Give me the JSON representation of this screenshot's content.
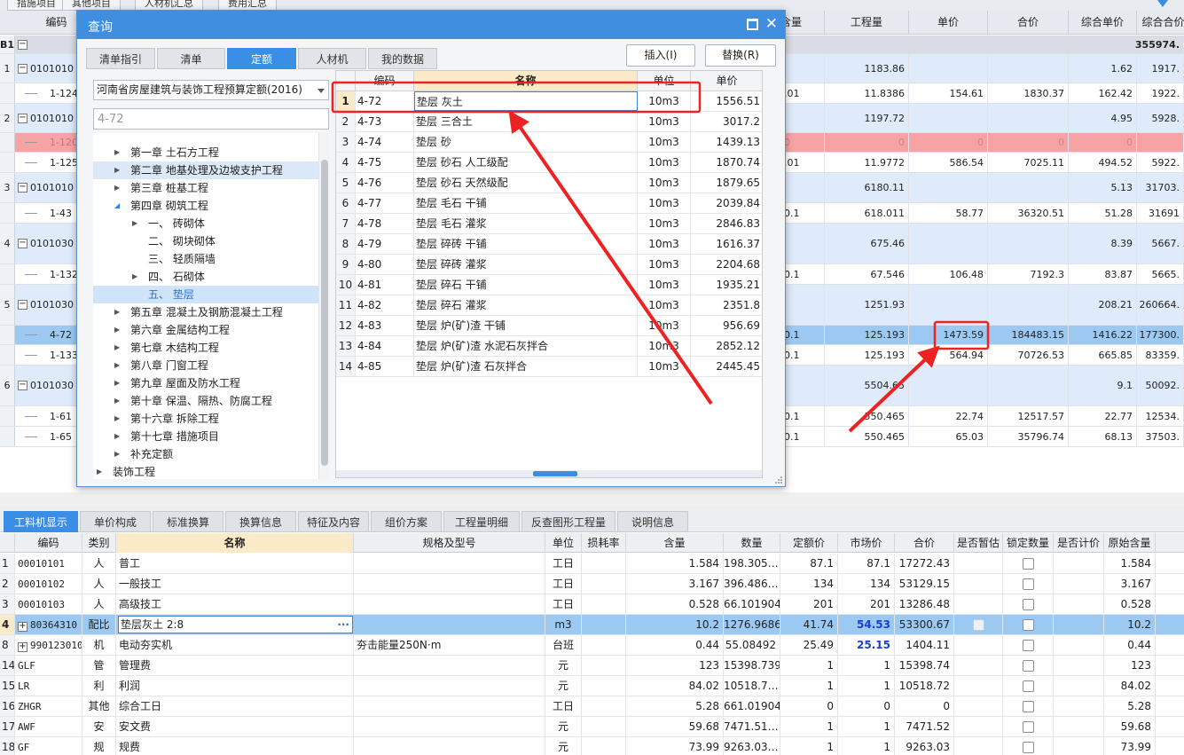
{
  "top_tabs": [
    "措施项目",
    "其他项目",
    "人材机汇总",
    "费用汇总"
  ],
  "bg_header": {
    "code": "编码",
    "qty": "工程量",
    "unit_price": "单价",
    "total_price": "合价",
    "comp_unit_price": "综合单价",
    "comp_total": "综合合价",
    "content_qty": "含量"
  },
  "bg_total_row": {
    "label": "B1",
    "comp_total": "355974."
  },
  "bg_rows": [
    {
      "idx": "1",
      "code": "0101010",
      "qty": "1183.86",
      "unit_price": "",
      "total_price": "",
      "comp_unit": "1.62",
      "comp_total": "1917.",
      "qty_prefix": "",
      "style": "blue"
    },
    {
      "idx": "",
      "code": "1-124",
      "qty": "11.8386",
      "unit_price": "154.61",
      "total_price": "1830.37",
      "comp_unit": "162.42",
      "comp_total": "1922.",
      "qty_prefix": ".01",
      "style": ""
    },
    {
      "idx": "2",
      "code": "0101010",
      "qty": "1197.72",
      "unit_price": "",
      "total_price": "",
      "comp_unit": "4.95",
      "comp_total": "5928.",
      "qty_prefix": "",
      "style": "blue"
    },
    {
      "idx": "",
      "code": "1-120",
      "qty": "0",
      "unit_price": "0",
      "total_price": "0",
      "comp_unit": "0",
      "comp_total": "",
      "qty_prefix": "0",
      "style": "red"
    },
    {
      "idx": "",
      "code": "1-125",
      "qty": "11.9772",
      "unit_price": "586.54",
      "total_price": "7025.11",
      "comp_unit": "494.52",
      "comp_total": "5922.",
      "qty_prefix": ".01",
      "style": ""
    },
    {
      "idx": "3",
      "code": "0101010",
      "qty": "6180.11",
      "unit_price": "",
      "total_price": "",
      "comp_unit": "5.13",
      "comp_total": "31703.",
      "qty_prefix": "",
      "style": "blue"
    },
    {
      "idx": "",
      "code": "1-43",
      "qty": "618.011",
      "unit_price": "58.77",
      "total_price": "36320.51",
      "comp_unit": "51.28",
      "comp_total": "31691",
      "qty_prefix": "0.1",
      "style": ""
    },
    {
      "idx": "4",
      "code": "0101030",
      "qty": "675.46",
      "unit_price": "",
      "total_price": "",
      "comp_unit": "8.39",
      "comp_total": "5667.",
      "qty_prefix": "",
      "style": "blue"
    },
    {
      "idx": "",
      "code": "1-132",
      "qty": "67.546",
      "unit_price": "106.48",
      "total_price": "7192.3",
      "comp_unit": "83.87",
      "comp_total": "5665.",
      "qty_prefix": "0.1",
      "style": ""
    },
    {
      "idx": "5",
      "code": "0101030",
      "qty": "1251.93",
      "unit_price": "",
      "total_price": "",
      "comp_unit": "208.21",
      "comp_total": "260664.",
      "qty_prefix": "",
      "style": "blue"
    },
    {
      "idx": "",
      "code": "4-72",
      "qty": "125.193",
      "unit_price": "1473.59",
      "total_price": "184483.15",
      "comp_unit": "1416.22",
      "comp_total": "177300.",
      "qty_prefix": "0.1",
      "style": "sel"
    },
    {
      "idx": "",
      "code": "1-133",
      "qty": "125.193",
      "unit_price": "564.94",
      "total_price": "70726.53",
      "comp_unit": "665.85",
      "comp_total": "83359.",
      "qty_prefix": "0.1",
      "style": ""
    },
    {
      "idx": "6",
      "code": "0101030",
      "qty": "5504.65",
      "unit_price": "",
      "total_price": "",
      "comp_unit": "9.1",
      "comp_total": "50092.",
      "qty_prefix": "",
      "style": "blue"
    },
    {
      "idx": "",
      "code": "1-61",
      "qty": "550.465",
      "unit_price": "22.74",
      "total_price": "12517.57",
      "comp_unit": "22.77",
      "comp_total": "12534.",
      "qty_prefix": "0.1",
      "style": ""
    },
    {
      "idx": "",
      "code": "1-65",
      "qty": "550.465",
      "unit_price": "65.03",
      "total_price": "35796.74",
      "comp_unit": "68.13",
      "comp_total": "37503.",
      "qty_prefix": "0.1",
      "style": ""
    }
  ],
  "dialog": {
    "title": "查询",
    "tabs": [
      "清单指引",
      "清单",
      "定额",
      "人材机",
      "我的数据"
    ],
    "insert_label": "插入(I)",
    "replace_label": "替换(R)",
    "library": "河南省房屋建筑与装饰工程预算定额(2016)",
    "search_value": "4-72",
    "tree": [
      {
        "label": "第一章 土石方工程",
        "level": 1,
        "arrow": "closed"
      },
      {
        "label": "第二章 地基处理及边坡支护工程",
        "level": 1,
        "arrow": "closed",
        "hl": true
      },
      {
        "label": "第三章 桩基工程",
        "level": 1,
        "arrow": "closed"
      },
      {
        "label": "第四章 砌筑工程",
        "level": 1,
        "arrow": "open"
      },
      {
        "label": "一、 砖砌体",
        "level": 2,
        "arrow": "closed"
      },
      {
        "label": "二、 砌块砌体",
        "level": 2,
        "arrow": ""
      },
      {
        "label": "三、 轻质隔墙",
        "level": 2,
        "arrow": ""
      },
      {
        "label": "四、 石砌体",
        "level": 2,
        "arrow": "closed"
      },
      {
        "label": "五、 垫层",
        "level": 2,
        "arrow": "",
        "sel": true
      },
      {
        "label": "第五章 混凝土及钢筋混凝土工程",
        "level": 1,
        "arrow": "closed"
      },
      {
        "label": "第六章 金属结构工程",
        "level": 1,
        "arrow": "closed"
      },
      {
        "label": "第七章 木结构工程",
        "level": 1,
        "arrow": "closed"
      },
      {
        "label": "第八章 门窗工程",
        "level": 1,
        "arrow": "closed"
      },
      {
        "label": "第九章 屋面及防水工程",
        "level": 1,
        "arrow": "closed"
      },
      {
        "label": "第十章 保温、隔热、防腐工程",
        "level": 1,
        "arrow": "closed"
      },
      {
        "label": "第十六章 拆除工程",
        "level": 1,
        "arrow": "closed"
      },
      {
        "label": "第十七章 措施项目",
        "level": 1,
        "arrow": "closed"
      },
      {
        "label": "补充定额",
        "level": 1,
        "arrow": "closed"
      },
      {
        "label": "装饰工程",
        "level": 0,
        "arrow": "closed"
      }
    ],
    "grid_headers": {
      "code": "编码",
      "name": "名称",
      "unit": "单位",
      "price": "单价"
    },
    "grid_rows": [
      {
        "idx": "1",
        "code": "4-72",
        "name": "垫层 灰土",
        "unit": "10m3",
        "price": "1556.51"
      },
      {
        "idx": "2",
        "code": "4-73",
        "name": "垫层 三合土",
        "unit": "10m3",
        "price": "3017.2"
      },
      {
        "idx": "3",
        "code": "4-74",
        "name": "垫层 砂",
        "unit": "10m3",
        "price": "1439.13"
      },
      {
        "idx": "4",
        "code": "4-75",
        "name": "垫层 砂石 人工级配",
        "unit": "10m3",
        "price": "1870.74"
      },
      {
        "idx": "5",
        "code": "4-76",
        "name": "垫层 砂石 天然级配",
        "unit": "10m3",
        "price": "1879.65"
      },
      {
        "idx": "6",
        "code": "4-77",
        "name": "垫层 毛石 干铺",
        "unit": "10m3",
        "price": "2039.84"
      },
      {
        "idx": "7",
        "code": "4-78",
        "name": "垫层 毛石 灌浆",
        "unit": "10m3",
        "price": "2846.83"
      },
      {
        "idx": "8",
        "code": "4-79",
        "name": "垫层 碎砖 干铺",
        "unit": "10m3",
        "price": "1616.37"
      },
      {
        "idx": "9",
        "code": "4-80",
        "name": "垫层 碎砖 灌浆",
        "unit": "10m3",
        "price": "2204.68"
      },
      {
        "idx": "10",
        "code": "4-81",
        "name": "垫层 碎石 干铺",
        "unit": "10m3",
        "price": "1935.21"
      },
      {
        "idx": "11",
        "code": "4-82",
        "name": "垫层 碎石 灌浆",
        "unit": "10m3",
        "price": "2351.8"
      },
      {
        "idx": "12",
        "code": "4-83",
        "name": "垫层 炉(矿)渣 干铺",
        "unit": "10m3",
        "price": "956.69"
      },
      {
        "idx": "13",
        "code": "4-84",
        "name": "垫层 炉(矿)渣 水泥石灰拌合",
        "unit": "10m3",
        "price": "2852.12"
      },
      {
        "idx": "14",
        "code": "4-85",
        "name": "垫层 炉(矿)渣 石灰拌合",
        "unit": "10m3",
        "price": "2445.45"
      }
    ]
  },
  "bottom_tabs": [
    "工料机显示",
    "单价构成",
    "标准换算",
    "换算信息",
    "特征及内容",
    "组价方案",
    "工程量明细",
    "反查图形工程量",
    "说明信息"
  ],
  "bottom_headers": {
    "code": "编码",
    "type": "类别",
    "name": "名称",
    "spec": "规格及型号",
    "unit": "单位",
    "loss": "损耗率",
    "content": "含量",
    "qty": "数量",
    "quota_price": "定额价",
    "market_price": "市场价",
    "total": "合价",
    "provisional": "是否暂估",
    "lock_qty": "锁定数量",
    "is_priced": "是否计价",
    "orig_content": "原始含量"
  },
  "bottom_rows": [
    {
      "idx": "1",
      "code": "00010101",
      "type": "人",
      "name": "普工",
      "spec": "",
      "unit": "工日",
      "content": "1.584",
      "qty": "198.305…",
      "quota_price": "87.1",
      "market_price": "87.1",
      "total": "17272.43",
      "orig": "1.584",
      "pm": false,
      "sel": false,
      "lock": true
    },
    {
      "idx": "2",
      "code": "00010102",
      "type": "人",
      "name": "一般技工",
      "spec": "",
      "unit": "工日",
      "content": "3.167",
      "qty": "396.486…",
      "quota_price": "134",
      "market_price": "134",
      "total": "53129.15",
      "orig": "3.167",
      "pm": false,
      "sel": false,
      "lock": true
    },
    {
      "idx": "3",
      "code": "00010103",
      "type": "人",
      "name": "高级技工",
      "spec": "",
      "unit": "工日",
      "content": "0.528",
      "qty": "66.101904",
      "quota_price": "201",
      "market_price": "201",
      "total": "13286.48",
      "orig": "0.528",
      "pm": false,
      "sel": false,
      "lock": true
    },
    {
      "idx": "4",
      "code": "80364310",
      "type": "配比",
      "name": "垫层灰土 2:8",
      "spec": "",
      "unit": "m3",
      "content": "10.2",
      "qty": "1276.9686",
      "quota_price": "41.74",
      "market_price": "54.53",
      "total": "53300.67",
      "orig": "10.2",
      "pm": true,
      "sel": true,
      "lock": true
    },
    {
      "idx": "8",
      "code": "990123010",
      "type": "机",
      "name": "电动夯实机",
      "spec": "夯击能量250N·m",
      "unit": "台班",
      "content": "0.44",
      "qty": "55.08492",
      "quota_price": "25.49",
      "market_price": "25.15",
      "total": "1404.11",
      "orig": "0.44",
      "pm": true,
      "sel": false,
      "lock": true
    },
    {
      "idx": "14",
      "code": "GLF",
      "type": "管",
      "name": "管理费",
      "spec": "",
      "unit": "元",
      "content": "123",
      "qty": "15398.739",
      "quota_price": "1",
      "market_price": "1",
      "total": "15398.74",
      "orig": "123",
      "pm": false,
      "sel": false,
      "lock": true
    },
    {
      "idx": "15",
      "code": "LR",
      "type": "利",
      "name": "利润",
      "spec": "",
      "unit": "元",
      "content": "84.02",
      "qty": "10518.7…",
      "quota_price": "1",
      "market_price": "1",
      "total": "10518.72",
      "orig": "84.02",
      "pm": false,
      "sel": false,
      "lock": true
    },
    {
      "idx": "16",
      "code": "ZHGR",
      "type": "其他",
      "name": "综合工日",
      "spec": "",
      "unit": "工日",
      "content": "5.28",
      "qty": "661.01904",
      "quota_price": "0",
      "market_price": "0",
      "total": "0",
      "orig": "5.28",
      "pm": false,
      "sel": false,
      "lock": true
    },
    {
      "idx": "17",
      "code": "AWF",
      "type": "安",
      "name": "安文费",
      "spec": "",
      "unit": "元",
      "content": "59.68",
      "qty": "7471.51…",
      "quota_price": "1",
      "market_price": "1",
      "total": "7471.52",
      "orig": "59.68",
      "pm": false,
      "sel": false,
      "lock": true
    },
    {
      "idx": "18",
      "code": "GF",
      "type": "规",
      "name": "规费",
      "spec": "",
      "unit": "元",
      "content": "73.99",
      "qty": "9263.03…",
      "quota_price": "1",
      "market_price": "1",
      "total": "9263.03",
      "orig": "73.99",
      "pm": false,
      "sel": false,
      "lock": true
    }
  ],
  "colors": {
    "accent": "#3a8ee6",
    "selected_row": "#9cc9f2",
    "annotation": "#ee2222",
    "deleted_row": "#f5a3a3"
  }
}
